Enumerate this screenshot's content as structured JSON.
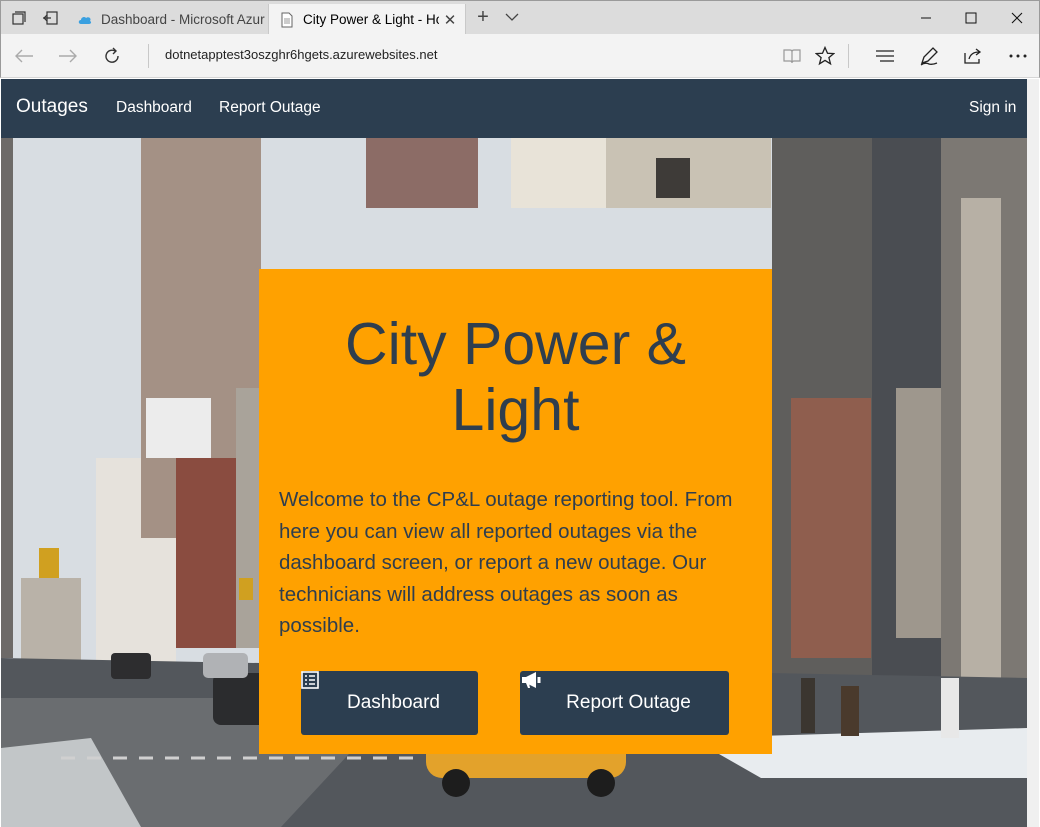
{
  "browser": {
    "tabs": [
      {
        "title": "Dashboard - Microsoft Azur",
        "favicon": "azure-cloud-icon",
        "active": false
      },
      {
        "title": "City Power & Light - Ho",
        "favicon": "page-icon",
        "active": true
      }
    ],
    "url": "dotnetapptest3oszghr6hgets.azurewebsites.net"
  },
  "navbar": {
    "brand": "Outages",
    "links": [
      "Dashboard",
      "Report Outage"
    ],
    "signin": "Sign in",
    "background": "#2c3e50"
  },
  "hero": {
    "title_line1": "City Power &",
    "title_line2": "Light",
    "body": "Welcome to the CP&L outage reporting tool. From here you can view all reported outages via the dashboard screen, or report a new outage. Our technicians will address outages as soon as possible.",
    "buttons": [
      {
        "label": "Dashboard",
        "icon": "list-icon"
      },
      {
        "label": "Report Outage",
        "icon": "megaphone-icon"
      }
    ],
    "panel_color": "#ffa100",
    "text_color": "#2f3e4e"
  }
}
